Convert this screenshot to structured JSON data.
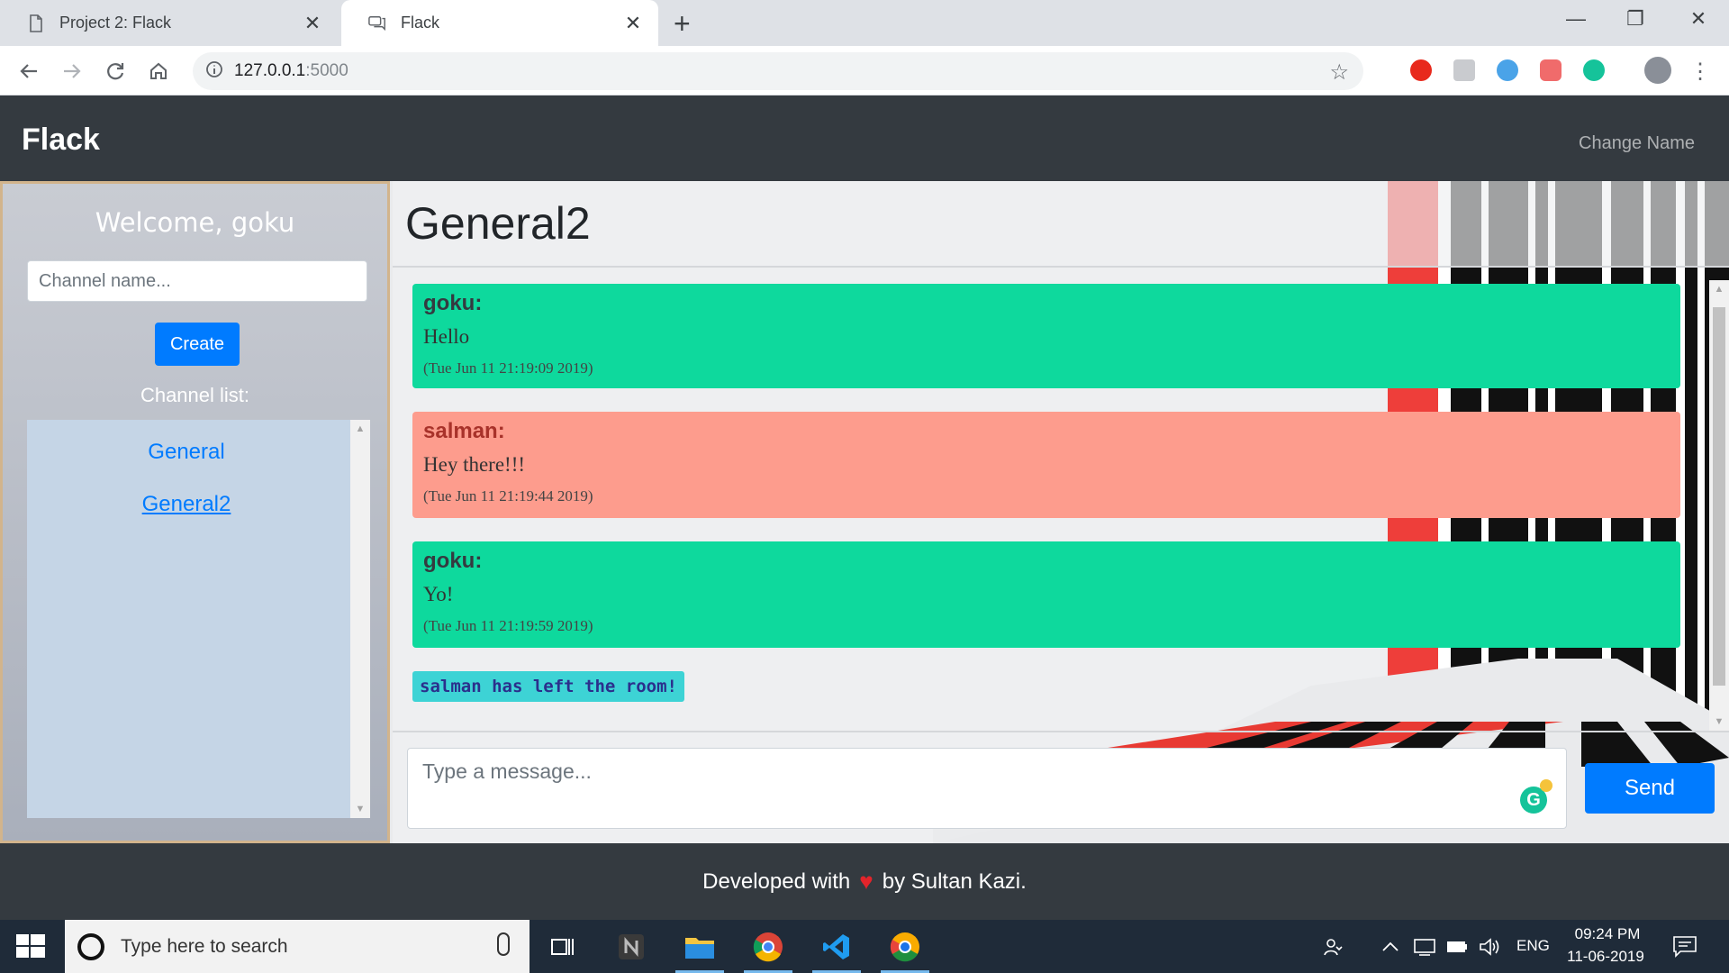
{
  "browser": {
    "tabs": [
      {
        "title": "Project 2: Flack",
        "active": false
      },
      {
        "title": "Flack",
        "active": true
      }
    ],
    "url_host": "127.0.0.1",
    "url_port": ":5000"
  },
  "navbar": {
    "brand": "Flack",
    "change_name": "Change Name"
  },
  "sidebar": {
    "welcome": "Welcome, goku",
    "channel_placeholder": "Channel name...",
    "create_label": "Create",
    "channel_list_label": "Channel list:",
    "channels": [
      "General",
      "General2"
    ],
    "current_channel": "General2"
  },
  "chat": {
    "title": "General2",
    "messages": [
      {
        "author": "goku:",
        "text": "Hello",
        "time": "(Tue Jun 11 21:19:09 2019)",
        "color": "#0ed99d"
      },
      {
        "author": "salman:",
        "text": "Hey there!!!",
        "time": "(Tue Jun 11 21:19:44 2019)",
        "color": "#fd9c8d"
      },
      {
        "author": "goku:",
        "text": "Yo!",
        "time": "(Tue Jun 11 21:19:59 2019)",
        "color": "#0ed99d"
      }
    ],
    "notice": "salman has left the room!",
    "message_placeholder": "Type a message...",
    "send_label": "Send"
  },
  "footer": {
    "prefix": "Developed with",
    "suffix": "by Sultan Kazi."
  },
  "taskbar": {
    "search_placeholder": "Type here to search",
    "language": "ENG",
    "time": "09:24 PM",
    "date": "11-06-2019"
  },
  "colors": {
    "primary": "#007bff",
    "navbar": "#343a40",
    "message_green": "#0ed99d",
    "message_red": "#fd9c8d",
    "notice": "#3dd3d5"
  }
}
